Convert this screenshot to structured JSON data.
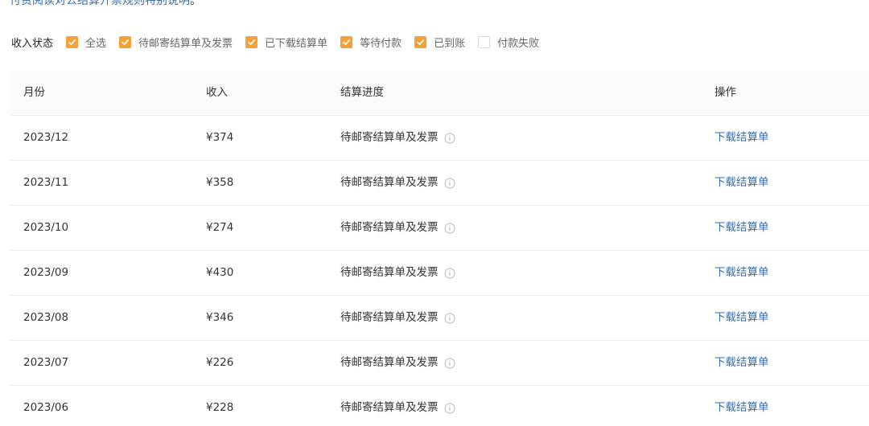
{
  "notice": {
    "link_text": "付费阅读对公结算开票规则特别说明",
    "tail": "。"
  },
  "filter": {
    "label": "收入状态",
    "options": [
      {
        "label": "全选",
        "checked": true
      },
      {
        "label": "待邮寄结算单及发票",
        "checked": true
      },
      {
        "label": "已下载结算单",
        "checked": true
      },
      {
        "label": "等待付款",
        "checked": true
      },
      {
        "label": "已到账",
        "checked": true
      },
      {
        "label": "付款失败",
        "checked": false
      }
    ]
  },
  "table": {
    "headers": {
      "month": "月份",
      "income": "收入",
      "progress": "结算进度",
      "action": "操作"
    },
    "rows": [
      {
        "month": "2023/12",
        "income": "¥374",
        "progress": "待邮寄结算单及发票",
        "action": "下载结算单"
      },
      {
        "month": "2023/11",
        "income": "¥358",
        "progress": "待邮寄结算单及发票",
        "action": "下载结算单"
      },
      {
        "month": "2023/10",
        "income": "¥274",
        "progress": "待邮寄结算单及发票",
        "action": "下载结算单"
      },
      {
        "month": "2023/09",
        "income": "¥430",
        "progress": "待邮寄结算单及发票",
        "action": "下载结算单"
      },
      {
        "month": "2023/08",
        "income": "¥346",
        "progress": "待邮寄结算单及发票",
        "action": "下载结算单"
      },
      {
        "month": "2023/07",
        "income": "¥226",
        "progress": "待邮寄结算单及发票",
        "action": "下载结算单"
      },
      {
        "month": "2023/06",
        "income": "¥228",
        "progress": "待邮寄结算单及发票",
        "action": "下载结算单"
      }
    ]
  },
  "colors": {
    "accent": "#f5a13a",
    "link": "#3a6ea8"
  },
  "icons": {
    "checkbox_check": "check-icon",
    "progress_info": "info-icon"
  }
}
